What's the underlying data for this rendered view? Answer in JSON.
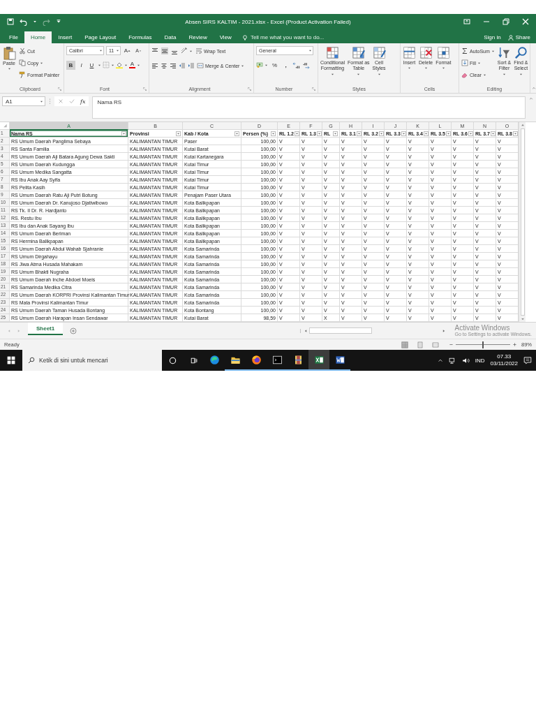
{
  "window": {
    "title": "Absen SIRS KALTIM - 2021.xlsx - Excel (Product Activation Failed)"
  },
  "ribbon_tabs": [
    {
      "label": "File",
      "selected": false
    },
    {
      "label": "Home",
      "selected": true
    },
    {
      "label": "Insert",
      "selected": false
    },
    {
      "label": "Page Layout",
      "selected": false
    },
    {
      "label": "Formulas",
      "selected": false
    },
    {
      "label": "Data",
      "selected": false
    },
    {
      "label": "Review",
      "selected": false
    },
    {
      "label": "View",
      "selected": false
    }
  ],
  "tell_me": {
    "placeholder": "Tell me what you want to do..."
  },
  "account": {
    "sign_in": "Sign in",
    "share": "Share"
  },
  "ribbon": {
    "clipboard": {
      "label": "Clipboard",
      "paste": "Paste",
      "cut": "Cut",
      "copy": "Copy",
      "format_painter": "Format Painter"
    },
    "font": {
      "label": "Font",
      "font_name": "Calibri",
      "font_size": "11",
      "grow": "A",
      "shrink": "A",
      "bold": "B",
      "italic": "I",
      "underline": "U",
      "font_color": "A"
    },
    "alignment": {
      "label": "Alignment",
      "wrap_text": "Wrap Text",
      "merge_center": "Merge & Center"
    },
    "number": {
      "label": "Number",
      "format": "General",
      "percent": "%",
      "comma": ","
    },
    "styles": {
      "label": "Styles",
      "buttons": [
        [
          "Conditional",
          "Formatting"
        ],
        [
          "Format as",
          "Table"
        ],
        [
          "Cell",
          "Styles"
        ]
      ]
    },
    "cells": {
      "label": "Cells",
      "buttons": [
        "Insert",
        "Delete",
        "Format"
      ]
    },
    "editing": {
      "label": "Editing",
      "autosum": "AutoSum",
      "fill": "Fill",
      "clear": "Clear",
      "sort_filter": [
        "Sort &",
        "Filter"
      ],
      "find_select": [
        "Find &",
        "Select"
      ]
    }
  },
  "formula_bar": {
    "name_box": "A1",
    "fx": "fx",
    "formula": "Nama RS"
  },
  "sheet": {
    "columns": [
      {
        "letter": "A",
        "selected": true
      },
      {
        "letter": "B",
        "selected": false
      },
      {
        "letter": "C",
        "selected": false
      },
      {
        "letter": "D",
        "selected": false
      },
      {
        "letter": "E",
        "selected": false
      },
      {
        "letter": "F",
        "selected": false
      },
      {
        "letter": "G",
        "selected": false
      },
      {
        "letter": "H",
        "selected": false
      },
      {
        "letter": "I",
        "selected": false
      },
      {
        "letter": "J",
        "selected": false
      },
      {
        "letter": "K",
        "selected": false
      },
      {
        "letter": "L",
        "selected": false
      },
      {
        "letter": "M",
        "selected": false
      },
      {
        "letter": "N",
        "selected": false
      },
      {
        "letter": "O",
        "selected": false
      }
    ],
    "header_row": {
      "row_number": "1",
      "cells": [
        "Nama RS",
        "Provinsi",
        "Kab / Kota",
        "Persen (%)",
        "RL 1.2",
        "RL 1.3",
        "RL",
        "RL 3.1",
        "RL 3.2",
        "RL 3.3",
        "RL 3.4",
        "RL 3.5",
        "RL 3.6",
        "RL 3.7",
        "RL 3.8"
      ]
    },
    "rows": [
      {
        "row_number": "2",
        "name": "RS Umum Daerah Panglima Sebaya",
        "province": "KALIMANTAN TIMUR",
        "city": "Paser",
        "percent": "100,00",
        "marks": [
          "V",
          "V",
          "V",
          "V",
          "V",
          "V",
          "V",
          "V",
          "V",
          "V",
          "V"
        ]
      },
      {
        "row_number": "3",
        "name": "RS Santa Familia",
        "province": "KALIMANTAN TIMUR",
        "city": "Kutai Barat",
        "percent": "100,00",
        "marks": [
          "V",
          "V",
          "V",
          "V",
          "V",
          "V",
          "V",
          "V",
          "V",
          "V",
          "V"
        ]
      },
      {
        "row_number": "4",
        "name": "RS Umum Daerah Aji Batara Agung Dewa Sakti",
        "province": "KALIMANTAN TIMUR",
        "city": "Kutai Kartanegara",
        "percent": "100,00",
        "marks": [
          "V",
          "V",
          "V",
          "V",
          "V",
          "V",
          "V",
          "V",
          "V",
          "V",
          "V"
        ]
      },
      {
        "row_number": "5",
        "name": "RS Umum Daerah Kudungga",
        "province": "KALIMANTAN TIMUR",
        "city": "Kutai Timur",
        "percent": "100,00",
        "marks": [
          "V",
          "V",
          "V",
          "V",
          "V",
          "V",
          "V",
          "V",
          "V",
          "V",
          "V"
        ]
      },
      {
        "row_number": "6",
        "name": "RS Umum Medika Sangatta",
        "province": "KALIMANTAN TIMUR",
        "city": "Kutai Timur",
        "percent": "100,00",
        "marks": [
          "V",
          "V",
          "V",
          "V",
          "V",
          "V",
          "V",
          "V",
          "V",
          "V",
          "V"
        ]
      },
      {
        "row_number": "7",
        "name": "RS Ibu Anak Aay Syifa",
        "province": "KALIMANTAN TIMUR",
        "city": "Kutai Timur",
        "percent": "100,00",
        "marks": [
          "V",
          "V",
          "V",
          "V",
          "V",
          "V",
          "V",
          "V",
          "V",
          "V",
          "V"
        ]
      },
      {
        "row_number": "8",
        "name": "RS Pelita Kasih",
        "province": "KALIMANTAN TIMUR",
        "city": "Kutai Timur",
        "percent": "100,00",
        "marks": [
          "V",
          "V",
          "V",
          "V",
          "V",
          "V",
          "V",
          "V",
          "V",
          "V",
          "V"
        ]
      },
      {
        "row_number": "9",
        "name": "RS Umum Daerah Ratu Aji Putri Botung",
        "province": "KALIMANTAN TIMUR",
        "city": "Penajam Paser Utara",
        "percent": "100,00",
        "marks": [
          "V",
          "V",
          "V",
          "V",
          "V",
          "V",
          "V",
          "V",
          "V",
          "V",
          "V"
        ]
      },
      {
        "row_number": "10",
        "name": "RS Umum Daerah Dr. Kanujoso Djatiwibowo",
        "province": "KALIMANTAN TIMUR",
        "city": "Kota Balikpapan",
        "percent": "100,00",
        "marks": [
          "V",
          "V",
          "V",
          "V",
          "V",
          "V",
          "V",
          "V",
          "V",
          "V",
          "V"
        ]
      },
      {
        "row_number": "11",
        "name": "RS Tk. II Dr. R. Hardjanto",
        "province": "KALIMANTAN TIMUR",
        "city": "Kota Balikpapan",
        "percent": "100,00",
        "marks": [
          "V",
          "V",
          "V",
          "V",
          "V",
          "V",
          "V",
          "V",
          "V",
          "V",
          "V"
        ]
      },
      {
        "row_number": "12",
        "name": "RS. Restu Ibu",
        "province": "KALIMANTAN TIMUR",
        "city": "Kota Balikpapan",
        "percent": "100,00",
        "marks": [
          "V",
          "V",
          "V",
          "V",
          "V",
          "V",
          "V",
          "V",
          "V",
          "V",
          "V"
        ]
      },
      {
        "row_number": "13",
        "name": "RS Ibu dan Anak Sayang Ibu",
        "province": "KALIMANTAN TIMUR",
        "city": "Kota Balikpapan",
        "percent": "100,00",
        "marks": [
          "V",
          "V",
          "V",
          "V",
          "V",
          "V",
          "V",
          "V",
          "V",
          "V",
          "V"
        ]
      },
      {
        "row_number": "14",
        "name": "RS Umum Daerah Beriman",
        "province": "KALIMANTAN TIMUR",
        "city": "Kota Balikpapan",
        "percent": "100,00",
        "marks": [
          "V",
          "V",
          "V",
          "V",
          "V",
          "V",
          "V",
          "V",
          "V",
          "V",
          "V"
        ]
      },
      {
        "row_number": "15",
        "name": "RS Hermina Balikpapan",
        "province": "KALIMANTAN TIMUR",
        "city": "Kota Balikpapan",
        "percent": "100,00",
        "marks": [
          "V",
          "V",
          "V",
          "V",
          "V",
          "V",
          "V",
          "V",
          "V",
          "V",
          "V"
        ]
      },
      {
        "row_number": "16",
        "name": "RS Umum Daerah Abdul Wahab Sjahranie",
        "province": "KALIMANTAN TIMUR",
        "city": "Kota Samarinda",
        "percent": "100,00",
        "marks": [
          "V",
          "V",
          "V",
          "V",
          "V",
          "V",
          "V",
          "V",
          "V",
          "V",
          "V"
        ]
      },
      {
        "row_number": "17",
        "name": "RS Umum Dirgahayu",
        "province": "KALIMANTAN TIMUR",
        "city": "Kota Samarinda",
        "percent": "100,00",
        "marks": [
          "V",
          "V",
          "V",
          "V",
          "V",
          "V",
          "V",
          "V",
          "V",
          "V",
          "V"
        ]
      },
      {
        "row_number": "18",
        "name": "RS Jiwa Atma Husada Mahakam",
        "province": "KALIMANTAN TIMUR",
        "city": "Kota Samarinda",
        "percent": "100,00",
        "marks": [
          "V",
          "V",
          "V",
          "V",
          "V",
          "V",
          "V",
          "V",
          "V",
          "V",
          "V"
        ]
      },
      {
        "row_number": "19",
        "name": "RS Umum Bhakti Nugraha",
        "province": "KALIMANTAN TIMUR",
        "city": "Kota Samarinda",
        "percent": "100,00",
        "marks": [
          "V",
          "V",
          "V",
          "V",
          "V",
          "V",
          "V",
          "V",
          "V",
          "V",
          "V"
        ]
      },
      {
        "row_number": "20",
        "name": "RS Umum Daerah Inche Abdoel Moeis",
        "province": "KALIMANTAN TIMUR",
        "city": "Kota Samarinda",
        "percent": "100,00",
        "marks": [
          "V",
          "V",
          "V",
          "V",
          "V",
          "V",
          "V",
          "V",
          "V",
          "V",
          "V"
        ]
      },
      {
        "row_number": "21",
        "name": "RS Samarinda Medika Citra",
        "province": "KALIMANTAN TIMUR",
        "city": "Kota Samarinda",
        "percent": "100,00",
        "marks": [
          "V",
          "V",
          "V",
          "V",
          "V",
          "V",
          "V",
          "V",
          "V",
          "V",
          "V"
        ]
      },
      {
        "row_number": "22",
        "name": "RS Umum Daerah KORPRI Provinsi Kalimantan Timur",
        "province": "KALIMANTAN TIMUR",
        "city": "Kota Samarinda",
        "percent": "100,00",
        "marks": [
          "V",
          "V",
          "V",
          "V",
          "V",
          "V",
          "V",
          "V",
          "V",
          "V",
          "V"
        ]
      },
      {
        "row_number": "23",
        "name": "RS Mata Provinsi Kalimantan Timur",
        "province": "KALIMANTAN TIMUR",
        "city": "Kota Samarinda",
        "percent": "100,00",
        "marks": [
          "V",
          "V",
          "V",
          "V",
          "V",
          "V",
          "V",
          "V",
          "V",
          "V",
          "V"
        ]
      },
      {
        "row_number": "24",
        "name": "RS Umum Daerah Taman Husada Bontang",
        "province": "KALIMANTAN TIMUR",
        "city": "Kota Bontang",
        "percent": "100,00",
        "marks": [
          "V",
          "V",
          "V",
          "V",
          "V",
          "V",
          "V",
          "V",
          "V",
          "V",
          "V"
        ]
      },
      {
        "row_number": "25",
        "name": "RS Umum Daerah Harapan Insan Sendawar",
        "province": "KALIMANTAN TIMUR",
        "city": "Kutai Barat",
        "percent": "98,59",
        "marks": [
          "V",
          "V",
          "X",
          "V",
          "V",
          "V",
          "V",
          "V",
          "V",
          "V",
          "V"
        ]
      }
    ]
  },
  "activation_notice": {
    "title": "Activate Windows",
    "detail": "Go to Settings to activate Windows."
  },
  "sheet_tabs": [
    {
      "label": "Sheet1",
      "selected": true
    }
  ],
  "status_bar": {
    "status": "Ready",
    "zoom": "89%",
    "zoom_slider": {
      "level": 0.5
    }
  },
  "taskbar": {
    "search": {
      "placeholder": "Ketik di sini untuk mencari"
    },
    "apps": [
      {
        "kind": "edge",
        "running": false,
        "selected": false
      },
      {
        "kind": "explorer",
        "running": true,
        "selected": false
      },
      {
        "kind": "firefox",
        "running": true,
        "selected": false
      },
      {
        "kind": "terminal",
        "running": true,
        "selected": false
      },
      {
        "kind": "archive",
        "running": true,
        "selected": false
      },
      {
        "kind": "excel",
        "running": true,
        "selected": true
      },
      {
        "kind": "word",
        "running": true,
        "selected": false
      }
    ],
    "language": "IND",
    "time": "07.33",
    "date": "03/11/2022"
  }
}
